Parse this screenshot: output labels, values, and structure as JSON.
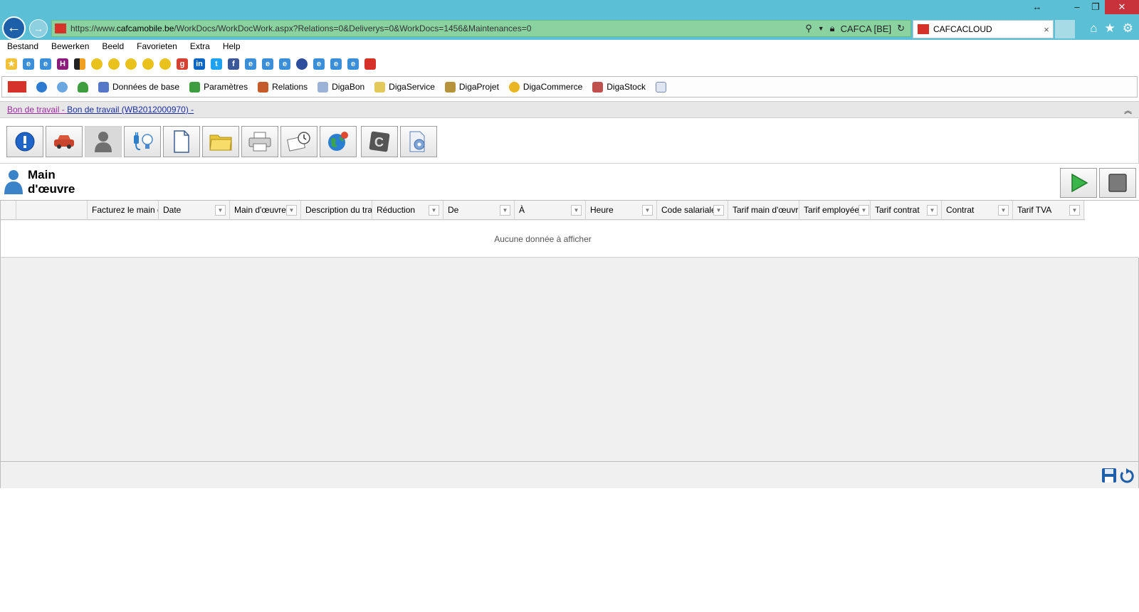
{
  "browser": {
    "url_prefix": "https://www.",
    "url_domain": "cafcamobile.be",
    "url_path": "/WorkDocs/WorkDocWork.aspx?Relations=0&Deliverys=0&WorkDocs=1456&Maintenances=0",
    "site_identity": "CAFCA [BE]",
    "tab_title": "CAFCACLOUD",
    "tab_close": "×"
  },
  "menu": [
    "Bestand",
    "Bewerken",
    "Beeld",
    "Favorieten",
    "Extra",
    "Help"
  ],
  "app_toolbar": {
    "items": [
      "Données de base",
      "Paramètres",
      "Relations",
      "DigaBon",
      "DigaService",
      "DigaProjet",
      "DigaCommerce",
      "DigaStock"
    ]
  },
  "breadcrumb": {
    "first": "Bon de travail",
    "sep": " - ",
    "second": "Bon de travail (WB2012000970) -"
  },
  "page": {
    "title": "Main d'œuvre"
  },
  "grid": {
    "columns": [
      {
        "label": "",
        "filter": false
      },
      {
        "label": "",
        "filter": false
      },
      {
        "label": "Facturez le main d",
        "filter": false
      },
      {
        "label": "Date",
        "filter": true
      },
      {
        "label": "Main d'œuvre",
        "filter": true
      },
      {
        "label": "Description du trav",
        "filter": false
      },
      {
        "label": "Réduction",
        "filter": true
      },
      {
        "label": "De",
        "filter": true
      },
      {
        "label": "À",
        "filter": true
      },
      {
        "label": "Heure",
        "filter": true
      },
      {
        "label": "Code salariale",
        "filter": true
      },
      {
        "label": "Tarif main d'œuvr",
        "filter": false
      },
      {
        "label": "Tarif employée",
        "filter": true
      },
      {
        "label": "Tarif contrat",
        "filter": true
      },
      {
        "label": "Contrat",
        "filter": true
      },
      {
        "label": "Tarif TVA",
        "filter": true
      }
    ],
    "empty_message": "Aucune donnée à afficher"
  }
}
